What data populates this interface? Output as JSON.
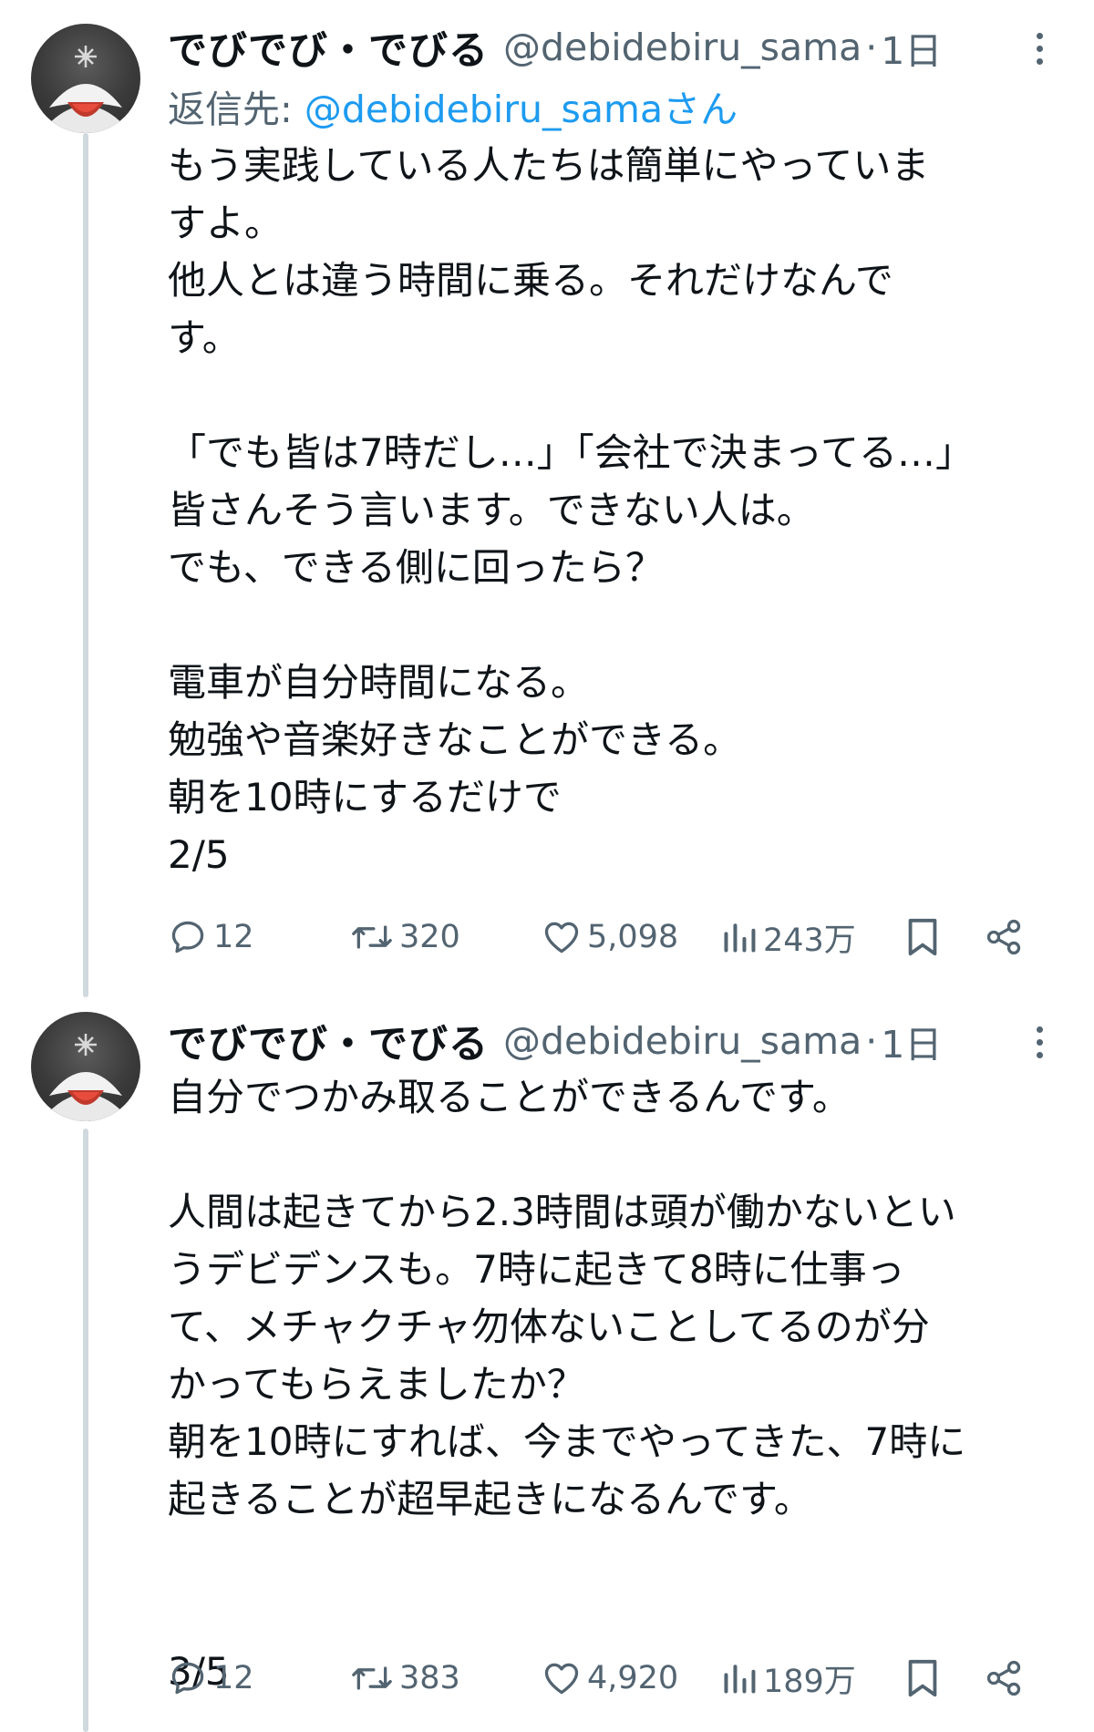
{
  "tweets": [
    {
      "author_name": "でびでび・でびる",
      "handle": "@debidebiru_sama",
      "separator": "·",
      "time": "1日",
      "reply_prefix": "返信先: ",
      "reply_mention": "@debidebiru_samaさん",
      "text": "もう実践している人たちは簡単にやっていま\nすよ。\n他人とは違う時間に乗る。それだけなんで\nす。\n\n「でも皆は7時だし…」「会社で決まってる…」\n皆さんそう言います。できない人は。\nでも、できる側に回ったら？\n\n電車が自分時間になる。\n勉強や音楽好きなことができる。\n朝を10時にするだけで\n2/5",
      "replies": "12",
      "retweets": "320",
      "likes": "5,098",
      "views": "243万"
    },
    {
      "author_name": "でびでび・でびる",
      "handle": "@debidebiru_sama",
      "separator": "·",
      "time": "1日",
      "text": "自分でつかみ取ることができるんです。\n\n人間は起きてから2.3時間は頭が働かないとい\nうデビデンスも。7時に起きて8時に仕事っ\nて、メチャクチャ勿体ないことしてるのが分\nかってもらえましたか？\n朝を10時にすれば、今までやってきた、7時に\n起きることが超早起きになるんです。\n\n\n3/5",
      "replies": "12",
      "retweets": "383",
      "likes": "4,920",
      "views": "189万"
    }
  ],
  "icons": {
    "reply": "reply-icon",
    "retweet": "retweet-icon",
    "like": "heart-icon",
    "views": "views-icon",
    "bookmark": "bookmark-icon",
    "share": "share-icon",
    "more": "more-icon"
  },
  "colors": {
    "text": "#0f1419",
    "secondary": "#536471",
    "link": "#1d9bf0",
    "thread_line": "#cfd9de"
  }
}
